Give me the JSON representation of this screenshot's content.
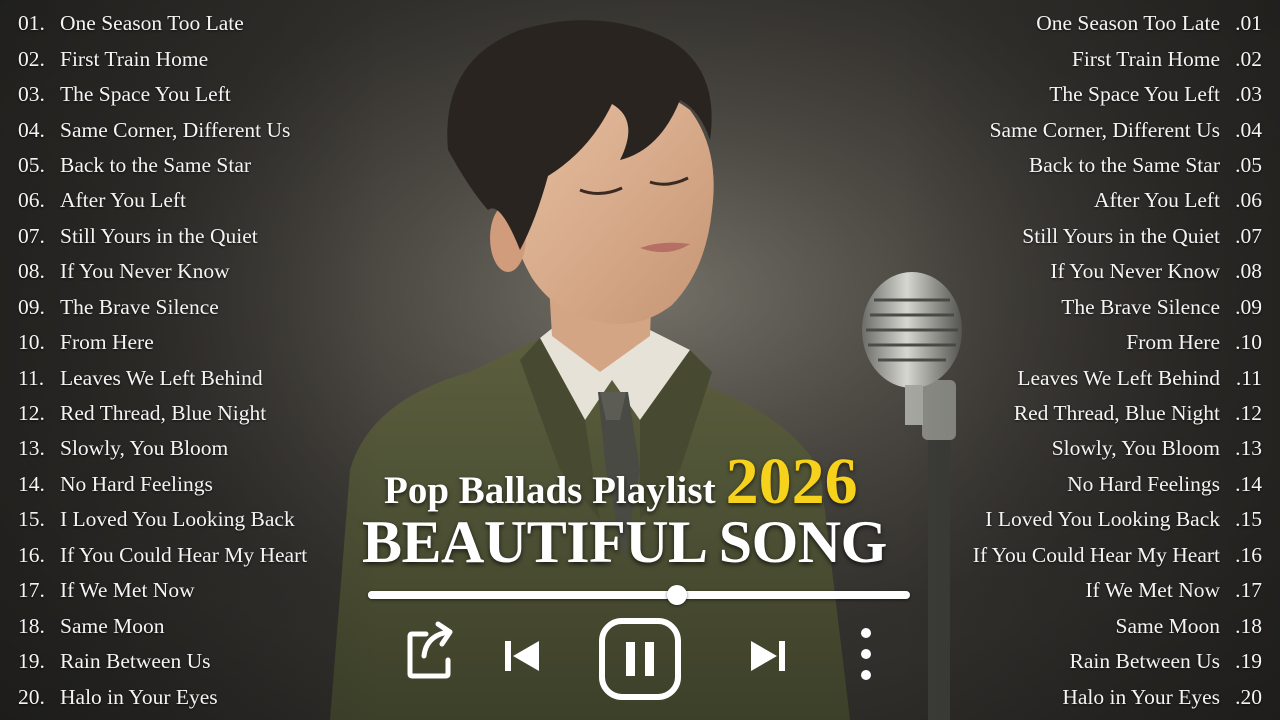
{
  "playlist": {
    "label": "Pop Ballads Playlist",
    "year": "2026",
    "title": "BEAUTIFUL SONG"
  },
  "tracks_left": [
    {
      "num": "01.",
      "title": "One Season Too Late"
    },
    {
      "num": "02.",
      "title": "First Train Home"
    },
    {
      "num": "03.",
      "title": "The Space You Left"
    },
    {
      "num": "04.",
      "title": "Same Corner, Different Us"
    },
    {
      "num": "05.",
      "title": "Back to the Same Star"
    },
    {
      "num": "06.",
      "title": "After You Left"
    },
    {
      "num": "07.",
      "title": "Still Yours in the Quiet"
    },
    {
      "num": "08.",
      "title": "If You Never Know"
    },
    {
      "num": "09.",
      "title": "The Brave Silence"
    },
    {
      "num": "10.",
      "title": "From Here"
    },
    {
      "num": "11.",
      "title": "Leaves We Left Behind"
    },
    {
      "num": "12.",
      "title": "Red Thread, Blue Night"
    },
    {
      "num": "13.",
      "title": "Slowly, You Bloom"
    },
    {
      "num": "14.",
      "title": "No Hard Feelings"
    },
    {
      "num": "15.",
      "title": "I Loved You Looking Back"
    },
    {
      "num": "16.",
      "title": "If You Could Hear My Heart"
    },
    {
      "num": "17.",
      "title": "If We Met Now"
    },
    {
      "num": "18.",
      "title": "Same Moon"
    },
    {
      "num": "19.",
      "title": "Rain Between Us"
    },
    {
      "num": "20.",
      "title": "Halo in Your Eyes"
    }
  ],
  "tracks_right": [
    {
      "num": ".01",
      "title": "One Season Too Late"
    },
    {
      "num": ".02",
      "title": "First Train Home"
    },
    {
      "num": ".03",
      "title": "The Space You Left"
    },
    {
      "num": ".04",
      "title": "Same Corner, Different Us"
    },
    {
      "num": ".05",
      "title": "Back to the Same Star"
    },
    {
      "num": ".06",
      "title": "After You Left"
    },
    {
      "num": ".07",
      "title": "Still Yours in the Quiet"
    },
    {
      "num": ".08",
      "title": "If You Never Know"
    },
    {
      "num": ".09",
      "title": "The Brave Silence"
    },
    {
      "num": ".10",
      "title": "From Here"
    },
    {
      "num": ".11",
      "title": "Leaves We Left Behind"
    },
    {
      "num": ".12",
      "title": "Red Thread, Blue Night"
    },
    {
      "num": ".13",
      "title": "Slowly, You Bloom"
    },
    {
      "num": ".14",
      "title": "No Hard Feelings"
    },
    {
      "num": ".15",
      "title": "I Loved You Looking Back"
    },
    {
      "num": ".16",
      "title": "If You Could Hear My Heart"
    },
    {
      "num": ".17",
      "title": "If We Met Now"
    },
    {
      "num": ".18",
      "title": "Same Moon"
    },
    {
      "num": ".19",
      "title": "Rain Between Us"
    },
    {
      "num": ".20",
      "title": "Halo in Your Eyes"
    }
  ],
  "player": {
    "progress_fraction": 0.57,
    "controls": [
      "share-icon",
      "previous-icon",
      "pause-icon",
      "next-icon",
      "more-vertical-icon"
    ]
  },
  "colors": {
    "year_accent": "#f6d21c",
    "text": "#ffffff",
    "suit": "#4e5234",
    "background": "#4f4c46"
  }
}
